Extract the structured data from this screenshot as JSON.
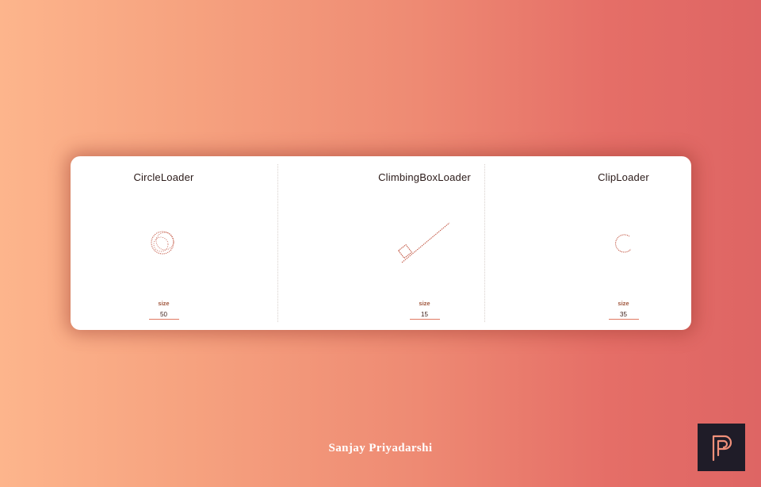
{
  "loaders": [
    {
      "title": "CircleLoader",
      "size_label": "size",
      "size_value": "50"
    },
    {
      "title": "ClimbingBoxLoader",
      "size_label": "size",
      "size_value": "15"
    },
    {
      "title": "ClipLoader",
      "size_label": "size",
      "size_value": "35"
    }
  ],
  "footer": {
    "author": "Sanjay Priyadarshi"
  },
  "colors": {
    "accent": "#e07a63",
    "loader_stroke": "#c0503c",
    "logo_bg": "#1f1c28"
  },
  "icons": {
    "logo": "p-monogram-logo"
  }
}
